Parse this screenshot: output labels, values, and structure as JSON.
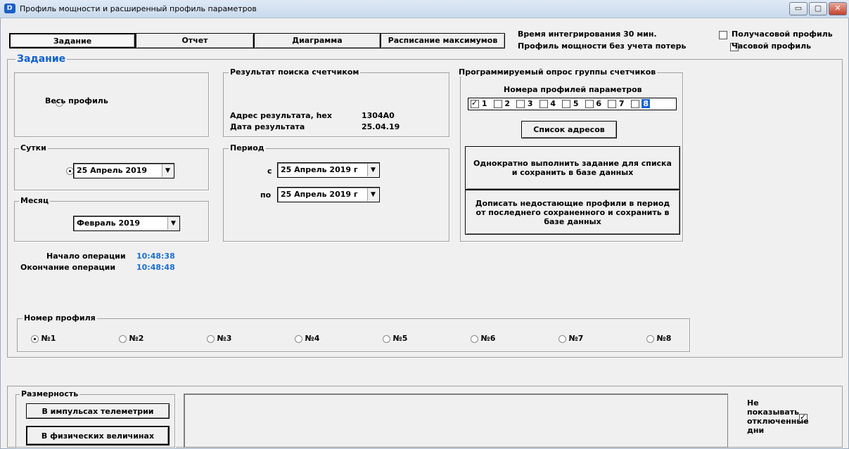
{
  "window": {
    "title": "Профиль мощности и расширенный профиль параметров",
    "app_icon": "app-logo-icon",
    "controls": {
      "minimize": "▭",
      "maximize": "▢",
      "close": "✕"
    }
  },
  "tabs": [
    {
      "label": "Задание",
      "active": true
    },
    {
      "label": "Отчет",
      "active": false
    },
    {
      "label": "Диаграмма",
      "active": false
    },
    {
      "label": "Расписание максимумов",
      "active": false
    }
  ],
  "info": {
    "integration": "Время интегрирования 30 мин.",
    "profile_note": "Профиль мощности без учета потерь"
  },
  "profile_options": {
    "half_hour": {
      "label": "Получасовой профиль",
      "checked": false
    },
    "hourly": {
      "label": "Часовой профиль",
      "checked": false
    }
  },
  "task": {
    "group_label": "Задание",
    "whole_profile": {
      "label": "Весь профиль",
      "checked": false
    },
    "day": {
      "group_label": "Сутки",
      "value": "25  Апрель  2019",
      "checked": true
    },
    "month": {
      "group_label": "Месяц",
      "value": "Февраль 2019",
      "checked": false
    },
    "search": {
      "group_label": "Результат поиска счетчиком",
      "address_label": "Адрес результата, hex",
      "address_value": "1304A0",
      "date_label": "Дата результата",
      "date_value": "25.04.19"
    },
    "period": {
      "group_label": "Период",
      "from_label": "с",
      "from_value": "25  Апрель  2019 г",
      "to_label": "по",
      "to_value": "25  Апрель  2019 г",
      "checked": false
    },
    "group_poll": {
      "group_label": "Программируемый опрос группы счетчиков",
      "numbers_label": "Номера профилей параметров",
      "numbers": [
        {
          "n": "1",
          "checked": true
        },
        {
          "n": "2",
          "checked": false
        },
        {
          "n": "3",
          "checked": false
        },
        {
          "n": "4",
          "checked": false
        },
        {
          "n": "5",
          "checked": false
        },
        {
          "n": "6",
          "checked": false
        },
        {
          "n": "7",
          "checked": false
        },
        {
          "n": "8",
          "checked": false
        }
      ],
      "address_list_button": "Список адресов",
      "run_once_button": "Однократно выполнить задание для списка и сохранить в базе данных",
      "append_button": "Дописать недостающие профили в период от последнего сохраненного и сохранить в базе данных"
    },
    "operation": {
      "start_label": "Начало операции",
      "start_time": "10:48:38",
      "end_label": "Окончание операции",
      "end_time": "10:48:48"
    },
    "profile_number": {
      "group_label": "Номер профиля",
      "options": [
        "№1",
        "№2",
        "№3",
        "№4",
        "№5",
        "№6",
        "№7",
        "№8"
      ],
      "selected_index": 0
    }
  },
  "dimension": {
    "group_label": "Размерность",
    "telemetry_button": "В импульсах телеметрии",
    "physical_button": "В физических величинах"
  },
  "hide_days": {
    "label": "Не показывать отключенные дни",
    "checked": true
  }
}
